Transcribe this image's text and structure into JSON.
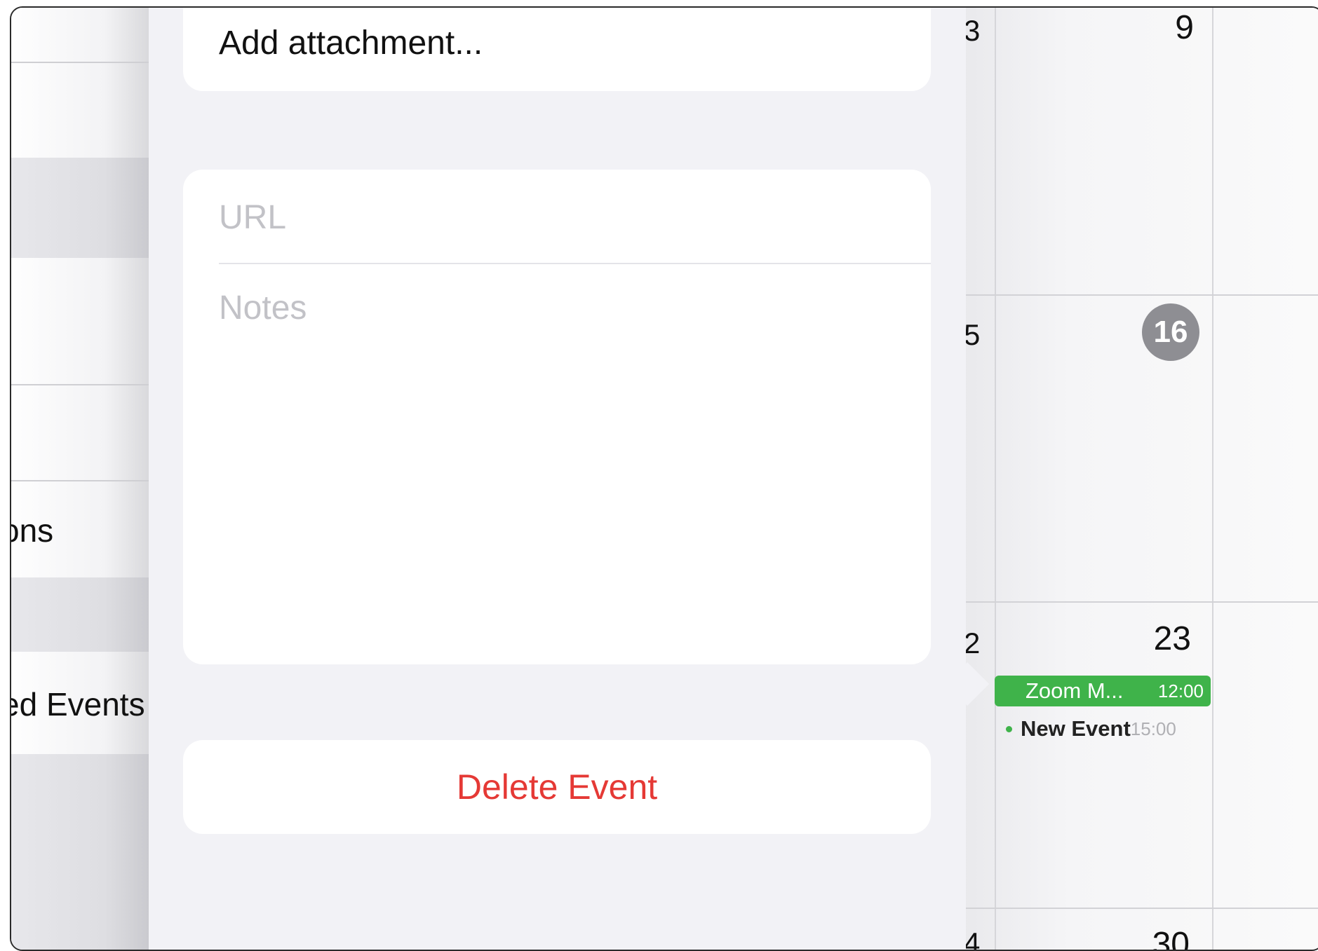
{
  "sidebar": {
    "items": [
      {
        "label": "ons"
      },
      {
        "label": "ed Events"
      }
    ]
  },
  "calendar": {
    "edge_digits": [
      "3",
      "5",
      "2",
      "4"
    ],
    "days": {
      "week1": "9",
      "week2_today": "16",
      "week3": "23",
      "week4": "30"
    },
    "events": [
      {
        "title": "Zoom M...",
        "time": "12:00",
        "color": "#3fb34a"
      },
      {
        "title": "New Event",
        "time": "15:00",
        "color": "#3fb34a"
      }
    ]
  },
  "event_sheet": {
    "attachment_label": "Add attachment...",
    "url_placeholder": "URL",
    "url_value": "",
    "notes_placeholder": "Notes",
    "notes_value": "",
    "delete_label": "Delete Event"
  },
  "colors": {
    "delete": "#e53935",
    "event_green": "#3fb34a",
    "today_badge": "#8e8e93"
  }
}
